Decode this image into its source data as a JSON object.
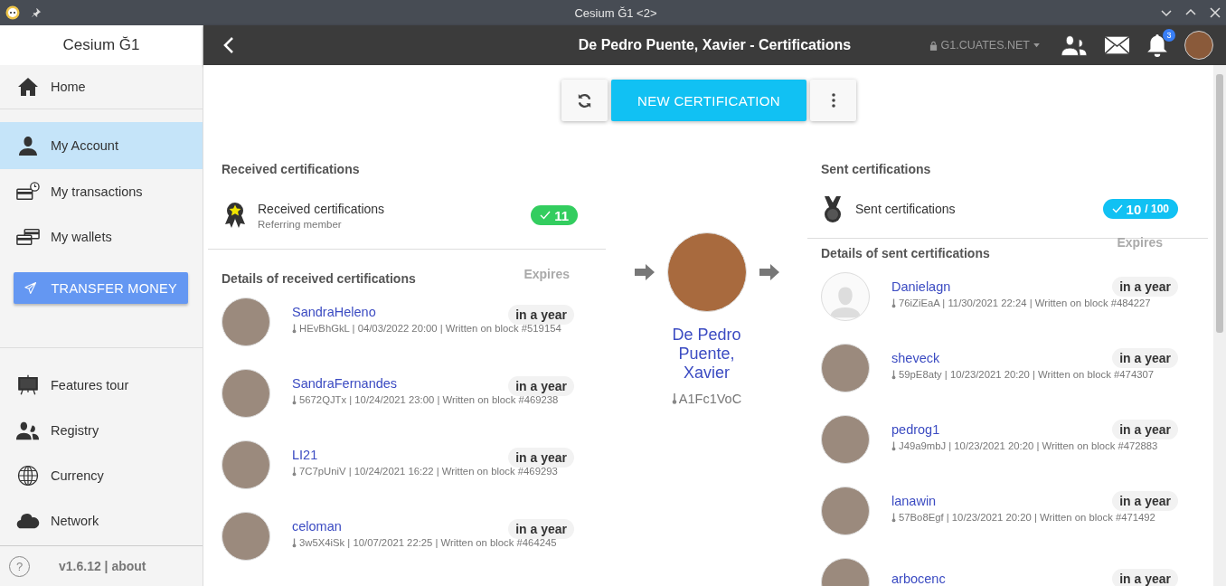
{
  "window": {
    "title": "Cesium Ğ1 <2>"
  },
  "sidebar": {
    "brand": "Cesium Ğ1",
    "items": [
      {
        "label": "Home",
        "selected": false
      },
      {
        "label": "My Account",
        "selected": true
      },
      {
        "label": "My transactions",
        "selected": false
      },
      {
        "label": "My wallets",
        "selected": false
      }
    ],
    "transfer_button": "TRANSFER MONEY",
    "bottom_items": [
      {
        "label": "Features tour",
        "selected": false
      },
      {
        "label": "Registry",
        "selected": false
      },
      {
        "label": "Currency",
        "selected": false
      },
      {
        "label": "Network",
        "selected": false
      }
    ],
    "help": "?",
    "footer": "v1.6.12 | about"
  },
  "header": {
    "title": "De Pedro Puente, Xavier - Certifications",
    "node": "G1.CUATES.NET",
    "notifications": "3"
  },
  "toolbar": {
    "primary_button": "NEW CERTIFICATION"
  },
  "received": {
    "heading": "Received certifications",
    "summary": {
      "title": "Received certifications",
      "subtitle": "Referring member",
      "count": "11"
    },
    "details_heading": "Details of received certifications",
    "expires_label": "Expires",
    "rows": [
      {
        "kind": "photo",
        "name": "SandraHeleno",
        "meta": "HEvBhGkL | 04/03/2022 20:00 | Written on block #519154",
        "expires": "in a year"
      },
      {
        "kind": "photo",
        "name": "SandraFernandes",
        "meta": "5672QJTx | 10/24/2021 23:00 | Written on block #469238",
        "expires": "in a year"
      },
      {
        "kind": "photo",
        "name": "LI21",
        "meta": "7C7pUniV | 10/24/2021 16:22 | Written on block #469293",
        "expires": "in a year"
      },
      {
        "kind": "photo",
        "name": "celoman",
        "meta": "3w5X4iSk | 10/07/2021 22:25 | Written on block #464245",
        "expires": "in a year"
      }
    ]
  },
  "identity": {
    "name": "De Pedro Puente, Xavier",
    "key": "A1Fc1VoC"
  },
  "sent": {
    "heading": "Sent certifications",
    "summary": {
      "title": "Sent certifications",
      "count": "10",
      "limit": "/ 100"
    },
    "details_heading": "Details of sent certifications",
    "expires_label": "Expires",
    "rows": [
      {
        "kind": "default",
        "name": "Danielagn",
        "meta": "76iZiEaA | 11/30/2021 22:24 | Written on block #484227",
        "expires": "in a year"
      },
      {
        "kind": "photo",
        "name": "sheveck",
        "meta": "59pE8aty | 10/23/2021 20:20 | Written on block #474307",
        "expires": "in a year"
      },
      {
        "kind": "photo",
        "name": "pedrog1",
        "meta": "J49a9mbJ | 10/23/2021 20:20 | Written on block #472883",
        "expires": "in a year"
      },
      {
        "kind": "photo",
        "name": "lanawin",
        "meta": "57Bo8Egf | 10/23/2021 20:20 | Written on block #471492",
        "expires": "in a year"
      },
      {
        "kind": "photo",
        "name": "arbocenc",
        "expires": "in a year"
      }
    ]
  }
}
